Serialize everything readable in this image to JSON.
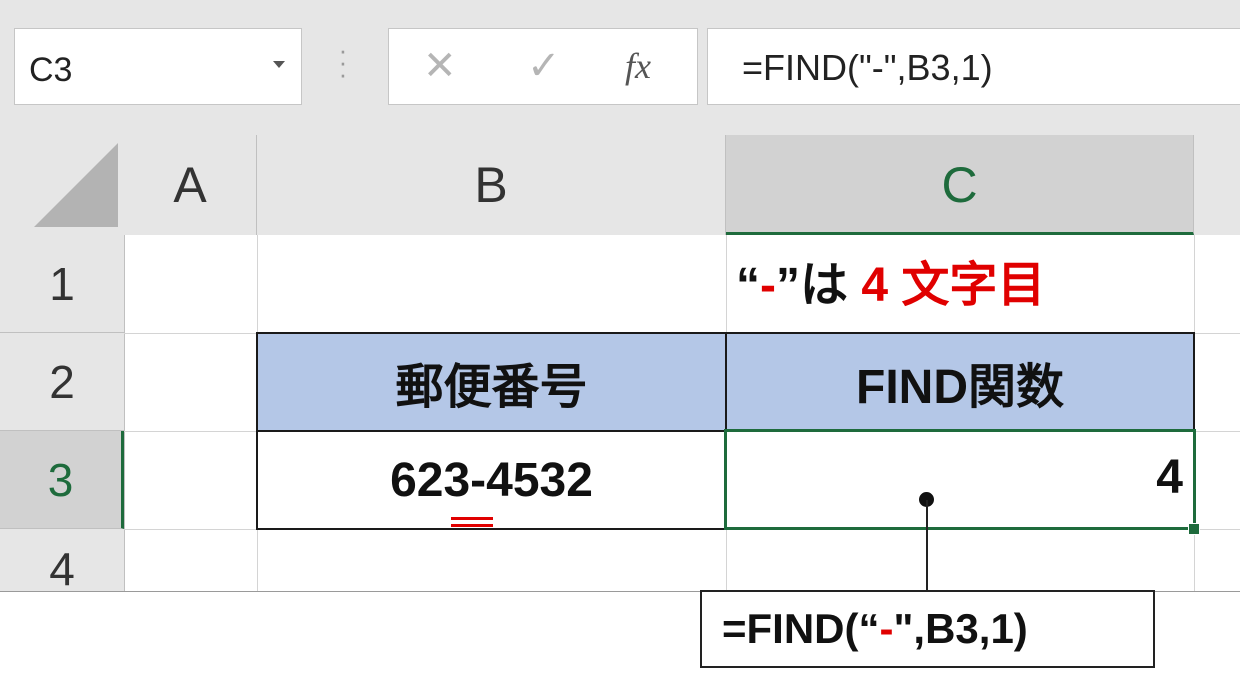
{
  "formula_bar": {
    "name_box": "C3",
    "cancel_icon": "✕",
    "enter_icon": "✓",
    "fx_label": "fx",
    "formula": "=FIND(\"-\",B3,1)"
  },
  "columns": [
    {
      "label": ""
    },
    {
      "label": "A"
    },
    {
      "label": "B"
    },
    {
      "label": "C"
    }
  ],
  "rows": [
    "1",
    "2",
    "3",
    "4"
  ],
  "cells": {
    "B2": "郵便番号",
    "C2": "FIND関数",
    "B3": "623-4532",
    "C3": "4"
  },
  "selected_cell": "C3",
  "annotation": {
    "open_quote": "“",
    "dash": "-",
    "close_quote": "”は",
    "number": "4",
    "suffix": "文字目"
  },
  "callout": {
    "prefix": "=FIND(“",
    "dash": "-",
    "suffix": "\",B3,1)"
  },
  "colors": {
    "header_fill": "#b4c7e7",
    "selection": "#1e6b3c",
    "highlight": "#e00000"
  }
}
